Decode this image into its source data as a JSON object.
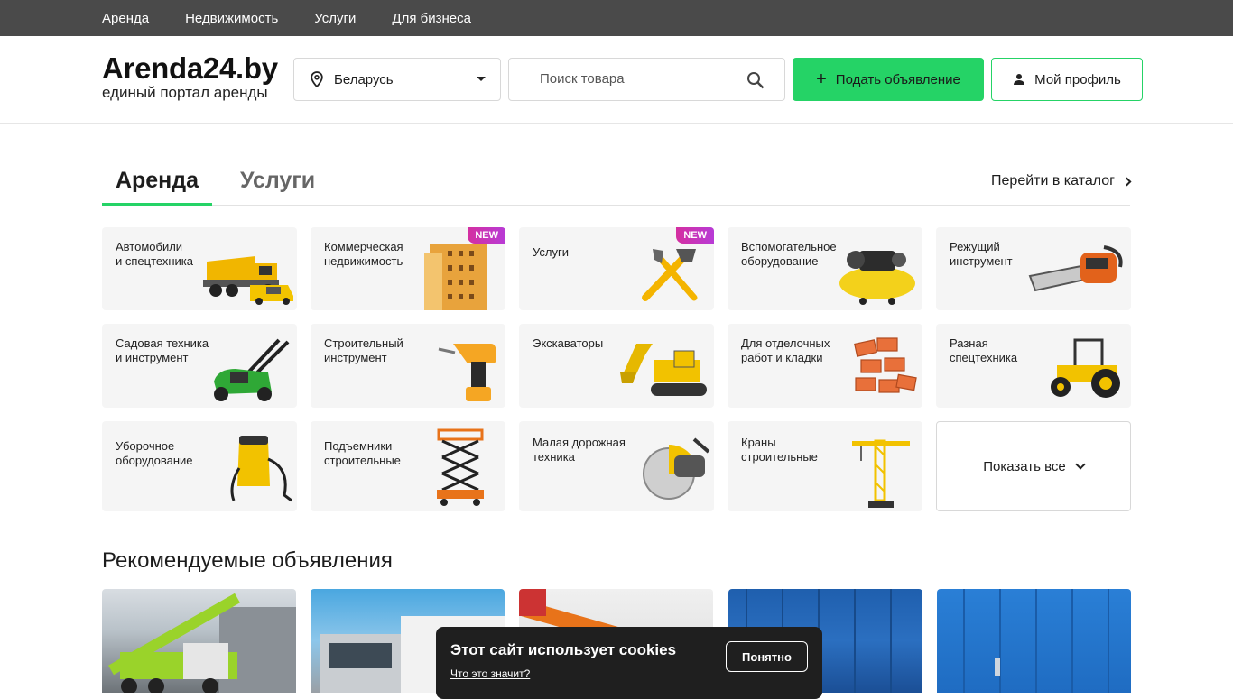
{
  "topnav": [
    "Аренда",
    "Недвижимость",
    "Услуги",
    "Для бизнеса"
  ],
  "logo": {
    "title": "Arenda24.by",
    "subtitle": "единый портал аренды"
  },
  "region": {
    "label": "Беларусь",
    "icon": "location-pin-icon"
  },
  "search": {
    "placeholder": "Поиск товара",
    "icon": "search-icon"
  },
  "post_button": {
    "label": "Подать объявление",
    "icon": "plus-icon"
  },
  "profile_button": {
    "label": "Мой профиль",
    "icon": "user-icon"
  },
  "tabs": {
    "active": "Аренда",
    "inactive": "Услуги"
  },
  "catalog_link": "Перейти в каталог",
  "categories": [
    {
      "label": "Автомобили\nи спецтехника",
      "badge": "",
      "icon": "dump-truck-icon"
    },
    {
      "label": "Коммерческая\nнедвижимость",
      "badge": "NEW",
      "icon": "building-icon"
    },
    {
      "label": "Услуги",
      "badge": "NEW",
      "icon": "tools-icon"
    },
    {
      "label": "Вспомогательное\nоборудование",
      "badge": "",
      "icon": "compressor-icon"
    },
    {
      "label": "Режущий\nинструмент",
      "badge": "",
      "icon": "chainsaw-icon"
    },
    {
      "label": "Садовая техника\nи инструмент",
      "badge": "",
      "icon": "lawn-mower-icon"
    },
    {
      "label": "Строительный\nинструмент",
      "badge": "",
      "icon": "drill-icon"
    },
    {
      "label": "Экскаваторы",
      "badge": "",
      "icon": "excavator-icon"
    },
    {
      "label": "Для отделочных\nработ и кладки",
      "badge": "",
      "icon": "bricks-icon"
    },
    {
      "label": "Разная\nспецтехника",
      "badge": "",
      "icon": "tractor-icon"
    },
    {
      "label": "Уборочное\nоборудование",
      "badge": "",
      "icon": "vacuum-icon"
    },
    {
      "label": "Подъемники\nстроительные",
      "badge": "",
      "icon": "scissor-lift-icon"
    },
    {
      "label": "Малая дорожная\nтехника",
      "badge": "",
      "icon": "road-saw-icon"
    },
    {
      "label": "Краны\nстроительные",
      "badge": "",
      "icon": "tower-crane-icon"
    }
  ],
  "show_all": "Показать все",
  "recommended_title": "Рекомендуемые объявления",
  "cookie": {
    "title": "Этот сайт использует cookies",
    "link": "Что это значит?",
    "button": "Понятно"
  },
  "colors": {
    "accent": "#25d366",
    "topbar": "#4a4a4a",
    "badge": "#c935b8"
  }
}
